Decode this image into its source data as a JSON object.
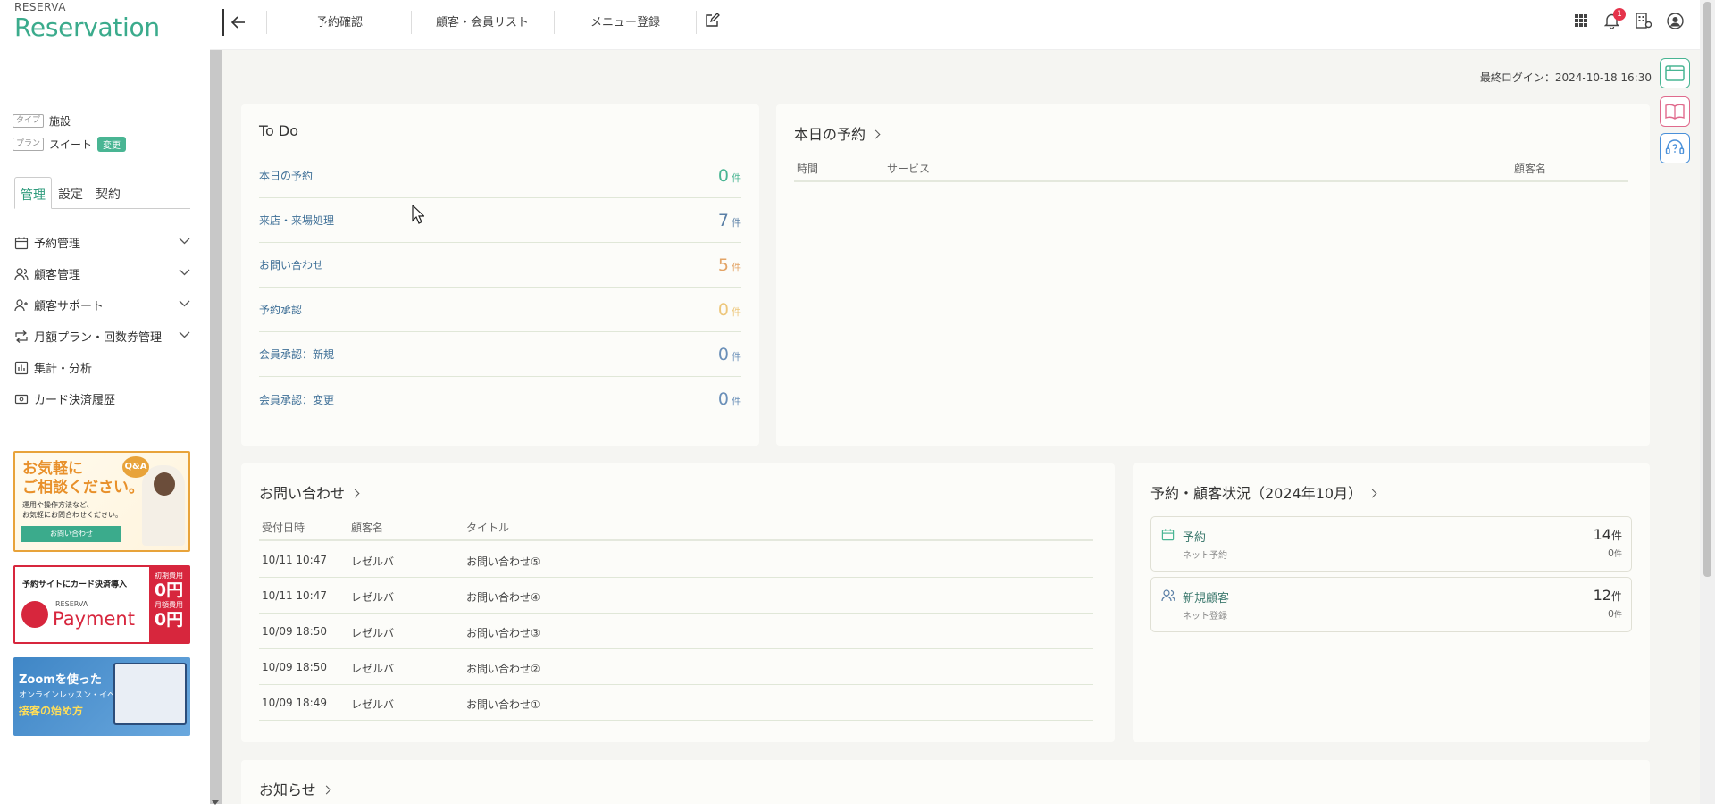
{
  "brand": {
    "small": "RESERVA",
    "big": "Reservation"
  },
  "account": {
    "type_tag": "タイプ",
    "type_value": "施設",
    "plan_tag": "プラン",
    "plan_value": "スイート",
    "change_label": "変更"
  },
  "tabs": [
    "管理",
    "設定",
    "契約"
  ],
  "nav": [
    "予約管理",
    "顧客管理",
    "顧客サポート",
    "月額プラン・回数券管理",
    "集計・分析",
    "カード決済履歴"
  ],
  "banners": {
    "b1": {
      "line1": "お気軽に",
      "line2": "ご相談ください。",
      "sub1": "運用や操作方法など、",
      "sub2": "お気軽にお問合わせください。",
      "button": "お問い合わせ",
      "qa": "Q&A"
    },
    "b2": {
      "title": "予約サイトにカード決済導入",
      "r": "RESERVA",
      "product": "Payment",
      "fee1": "初期費用",
      "fee1v": "0円",
      "fee2": "月額費用",
      "fee2v": "0円"
    },
    "b3": {
      "line1": "Zoomを使った",
      "line2": "オンラインレッスン・イベント・",
      "line3": "接客の始め方"
    }
  },
  "topbar": {
    "links": [
      "予約確認",
      "顧客・会員リスト",
      "メニュー登録"
    ],
    "notification_count": "1"
  },
  "last_login": "最終ログイン：2024-10-18 16:30",
  "todo": {
    "title": "To Do",
    "unit": "件",
    "rows": [
      {
        "label": "本日の予約",
        "value": "0",
        "color": "#49b593"
      },
      {
        "label": "来店・来場処理",
        "value": "7",
        "color": "#5a7fa6"
      },
      {
        "label": "お問い合わせ",
        "value": "5",
        "color": "#e3a466"
      },
      {
        "label": "予約承認",
        "value": "0",
        "color": "#edc67a"
      },
      {
        "label": "会員承認：新規",
        "value": "0",
        "color": "#6a8fb8"
      },
      {
        "label": "会員承認：変更",
        "value": "0",
        "color": "#6a8fb8"
      }
    ]
  },
  "today": {
    "title": "本日の予約",
    "headers": [
      "時間",
      "サービス",
      "顧客名"
    ]
  },
  "inquiries": {
    "title": "お問い合わせ",
    "headers": [
      "受付日時",
      "顧客名",
      "タイトル"
    ],
    "rows": [
      [
        "10/11 10:47",
        "レゼルバ",
        "お問い合わせ⑤"
      ],
      [
        "10/11 10:47",
        "レゼルバ",
        "お問い合わせ④"
      ],
      [
        "10/09 18:50",
        "レゼルバ",
        "お問い合わせ③"
      ],
      [
        "10/09 18:50",
        "レゼルバ",
        "お問い合わせ②"
      ],
      [
        "10/09 18:49",
        "レゼルバ",
        "お問い合わせ①"
      ]
    ]
  },
  "status": {
    "title": "予約・顧客状況（2024年10月）",
    "items": [
      {
        "label": "予約",
        "sub": "ネット予約",
        "value": "14",
        "sub_value": "0",
        "unit": "件"
      },
      {
        "label": "新規顧客",
        "sub": "ネット登録",
        "value": "12",
        "sub_value": "0",
        "unit": "件"
      }
    ]
  },
  "news": {
    "title": "お知らせ"
  }
}
